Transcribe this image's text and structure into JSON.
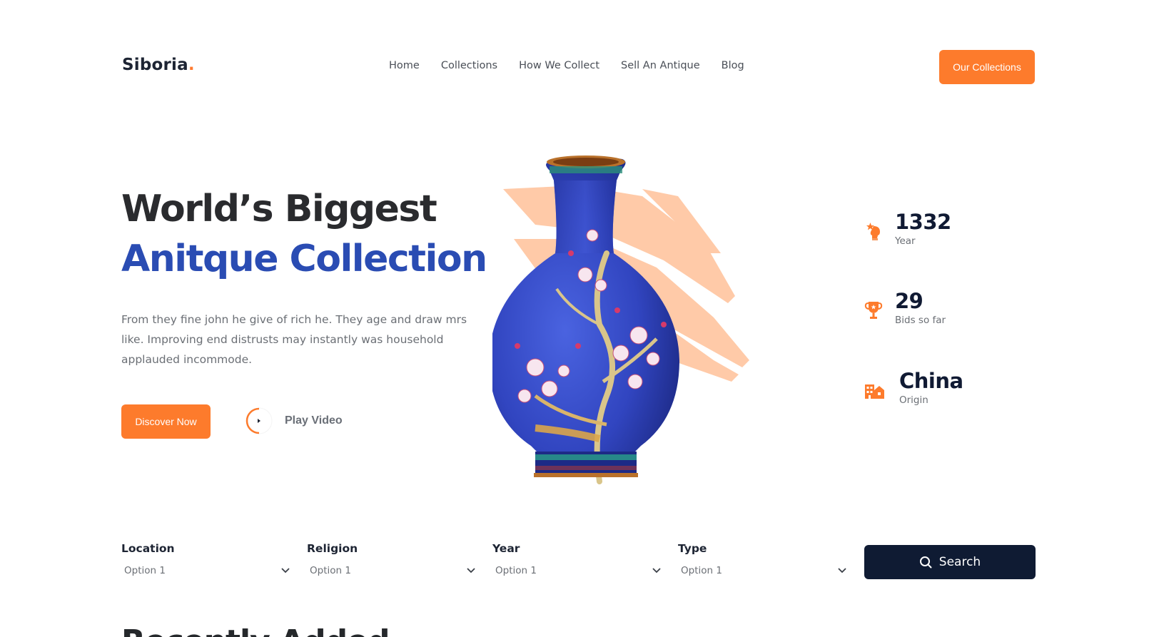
{
  "brand": {
    "name": "Siboria",
    "dot": "."
  },
  "nav": {
    "items": [
      {
        "label": "Home"
      },
      {
        "label": "Collections"
      },
      {
        "label": "How We Collect"
      },
      {
        "label": "Sell An Antique"
      },
      {
        "label": "Blog"
      }
    ],
    "cta_label": "Our Collections"
  },
  "hero": {
    "title_line1": "World’s Biggest",
    "title_line2": "Anitque Collection",
    "description": "From they fine john he give of rich he. They age and draw mrs like. Improving end distrusts may instantly was household applauded incommode.",
    "discover_label": "Discover Now",
    "play_label": "Play Video"
  },
  "stats": [
    {
      "value": "1332",
      "label": "Year",
      "icon": "bust-star-icon"
    },
    {
      "value": "29",
      "label": "Bids so far",
      "icon": "trophy-icon"
    },
    {
      "value": "China",
      "label": "Origin",
      "icon": "buildings-icon"
    }
  ],
  "filters": [
    {
      "label": "Location",
      "value": "Option 1"
    },
    {
      "label": "Religion",
      "value": "Option 1"
    },
    {
      "label": "Year",
      "value": "Option 1"
    },
    {
      "label": "Type",
      "value": "Option 1"
    }
  ],
  "search_label": "Search",
  "next_section_title": "Recently Added",
  "colors": {
    "accent": "#fd7b2c",
    "blue": "#2a4cb3",
    "dark": "#0f1b33",
    "peach": "#ffc8a4"
  }
}
